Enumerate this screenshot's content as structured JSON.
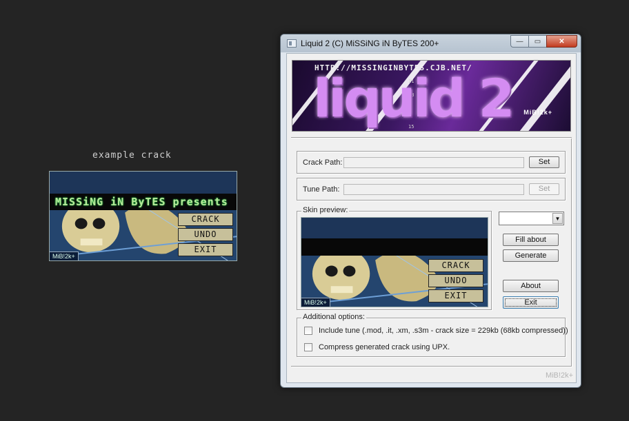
{
  "example": {
    "label": "example crack",
    "skin": {
      "bar_text": "MISSiNG iN ByTES presents",
      "buttons": [
        "CRACK",
        "UNDO",
        "EXIT"
      ],
      "badge": "MiB!2k+"
    }
  },
  "window": {
    "title": "Liquid 2 (C) MiSSiNG iN ByTES 200+",
    "controls": {
      "minimize": "—",
      "maximize": "▭",
      "close": "✕"
    },
    "banner": {
      "url": "HTTP://MISSINGINBYTES.CJB.NET/",
      "logo": "liquid 2",
      "tag": "MiB!2k+"
    },
    "crack_path": {
      "label": "Crack Path:",
      "value": "",
      "button": "Set"
    },
    "tune_path": {
      "label": "Tune Path:",
      "value": "",
      "button": "Set"
    },
    "skin_preview": {
      "legend": "Skin preview:",
      "buttons": [
        "CRACK",
        "UNDO",
        "EXIT"
      ],
      "badge": "MiB!2k+"
    },
    "combo": {
      "value": ""
    },
    "buttons": {
      "fill_about": "Fill about",
      "generate": "Generate",
      "about": "About",
      "exit": "Exit"
    },
    "options": {
      "legend": "Additional options:",
      "include_tune": "Include tune (.mod, .it, .xm, .s3m - crack size = 229kb (68kb compressed))",
      "compress": "Compress generated crack using UPX."
    },
    "footer_brand": "MiB!2k+"
  }
}
